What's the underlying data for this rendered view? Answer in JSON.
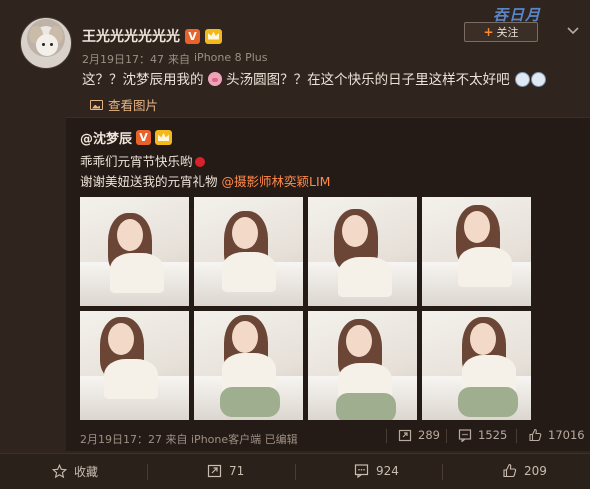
{
  "author": {
    "name": "王光光光光光光",
    "meta_time": "2月19日17：47",
    "meta_from": "来自",
    "meta_device": "iPhone 8 Plus"
  },
  "watermark": "吞日月",
  "follow_label": "关注",
  "post": {
    "text_part1": "这？？沈梦辰用我的",
    "text_part2": "头汤圆图？？在这个快乐的日子里这样不太好吧",
    "view_pictures": "查看图片"
  },
  "retweet": {
    "user": "@沈梦辰",
    "line1": "乖乖们元宵节快乐哟",
    "line2_prefix": "谢谢美妞送我的元宵礼物 ",
    "line2_mention": "@摄影师林奕颖LIM",
    "time": "2月19日17：27",
    "from": "来自",
    "device": "iPhone客户端",
    "edited": "已编辑",
    "reposts": "289",
    "comments": "1525",
    "likes": "17016"
  },
  "footer": {
    "favorite": "收藏",
    "reposts": "71",
    "comments": "924",
    "likes": "209"
  },
  "colors": {
    "background": "#2f241e",
    "accent_orange": "#ff8a4c",
    "link_gold": "#e6b383",
    "vip_orange": "#e8632c"
  }
}
